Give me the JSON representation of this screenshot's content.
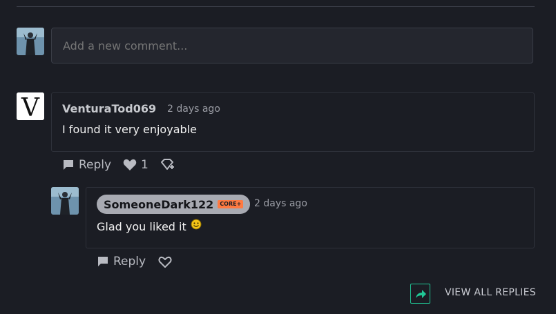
{
  "composer": {
    "placeholder": "Add a new comment..."
  },
  "comments": [
    {
      "author": "VenturaTod069",
      "time": "2 days ago",
      "text": "I found it very enjoyable",
      "reply_label": "Reply",
      "like_count": "1",
      "avatar_letter": "V"
    }
  ],
  "reply": {
    "author": "SomeoneDark122",
    "badge": "CORE+",
    "time": "2 days ago",
    "text": "Glad you liked it",
    "reply_label": "Reply"
  },
  "view_all": {
    "label": "VIEW ALL REPLIES"
  },
  "colors": {
    "background": "#1b1d24",
    "accent": "#20c997",
    "badge": "#ff7a42"
  }
}
